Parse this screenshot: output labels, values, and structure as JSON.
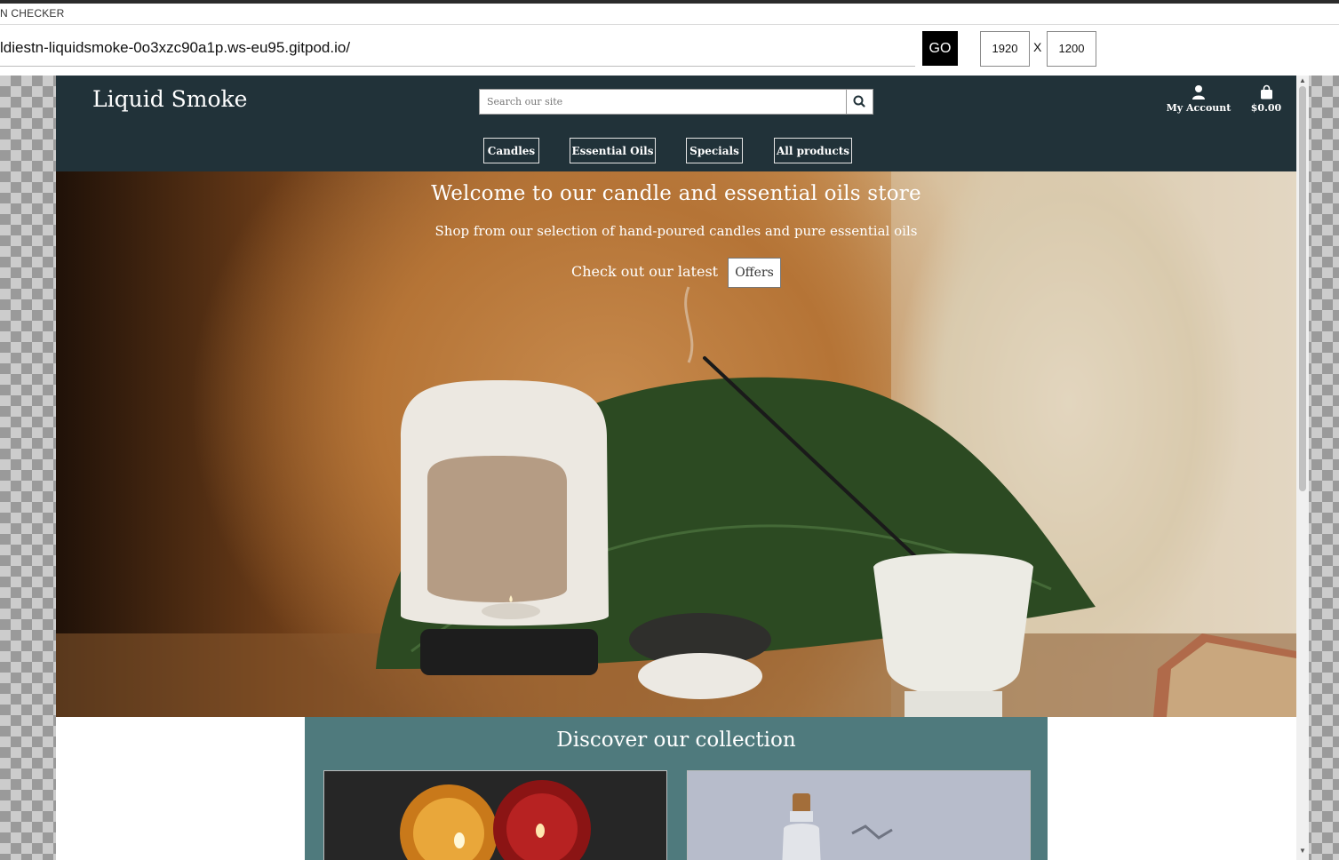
{
  "checker": {
    "title": "N CHECKER",
    "url": "ldiestn-liquidsmoke-0o3xzc90a1p.ws-eu95.gitpod.io/",
    "go_label": "GO",
    "width_value": "1920",
    "separator": "X",
    "height_value": "1200"
  },
  "site": {
    "brand": "Liquid Smoke",
    "search": {
      "placeholder": "Search our site"
    },
    "account_label": "My Account",
    "cart_total": "$0.00",
    "nav": [
      {
        "label": "Candles"
      },
      {
        "label": "Essential Oils"
      },
      {
        "label": "Specials"
      },
      {
        "label": "All products"
      }
    ],
    "hero": {
      "title": "Welcome to our candle and essential oils store",
      "subtitle": "Shop from our selection of hand-poured candles and pure essential oils",
      "cta_text": "Check out our latest",
      "offers_label": "Offers"
    },
    "collection": {
      "title": "Discover our collection"
    }
  },
  "colors": {
    "header_bg": "#213239",
    "collection_bg": "#4f7a7d"
  },
  "icons": [
    "user-icon",
    "shopping-bag-icon",
    "search-icon"
  ]
}
